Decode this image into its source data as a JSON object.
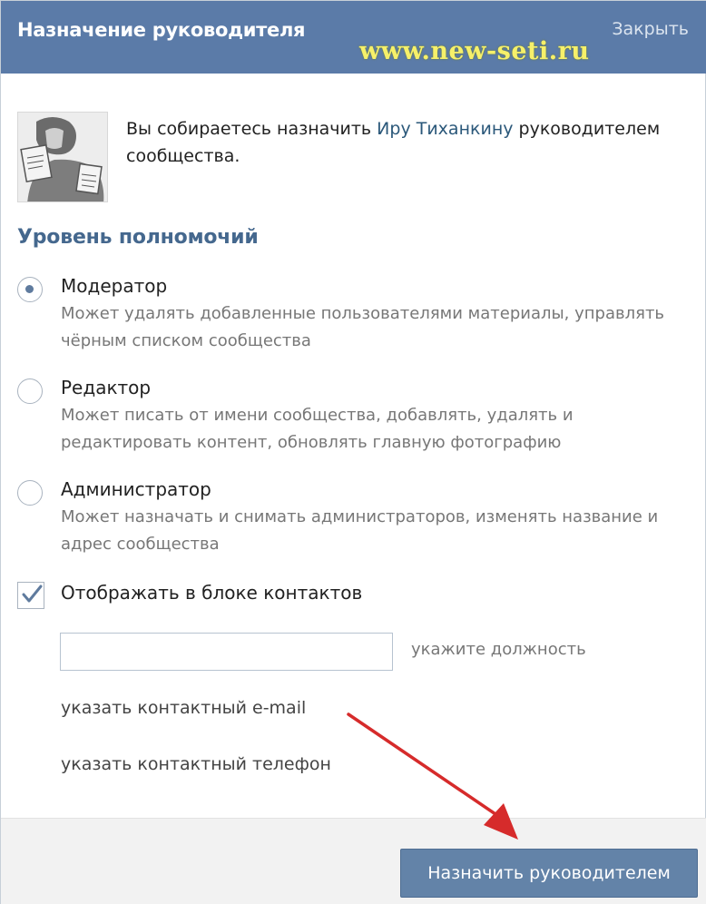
{
  "header": {
    "title": "Назначение руководителя",
    "close_label": "Закрыть",
    "watermark": "www.new-seti.ru"
  },
  "intro": {
    "text_before": "Вы собираетесь назначить ",
    "user_link": "Иру Тиханкину",
    "text_after": " руководителем сообщества."
  },
  "level": {
    "title": "Уровень полномочий",
    "options": [
      {
        "label": "Модератор",
        "description": "Может удалять добавленные пользователями материалы, управлять чёрным списком сообщества",
        "selected": true
      },
      {
        "label": "Редактор",
        "description": "Может писать от имени сообщества, добавлять, удалять и редактировать контент, обновлять главную фотографию",
        "selected": false
      },
      {
        "label": "Администратор",
        "description": "Может назначать и снимать администраторов, изменять название и адрес сообщества",
        "selected": false
      }
    ]
  },
  "contacts": {
    "show_label": "Отображать в блоке контактов",
    "checked": true,
    "position_value": "",
    "position_hint": "укажите должность",
    "email_link": "указать контактный e-mail",
    "phone_link": "указать контактный телефон"
  },
  "footer": {
    "submit_label": "Назначить руководителем"
  },
  "colors": {
    "header_bg": "#5b7ba8",
    "link": "#2b587a",
    "section_title": "#45688e",
    "button_bg": "#6383a8",
    "arrow": "#d62b2b"
  }
}
